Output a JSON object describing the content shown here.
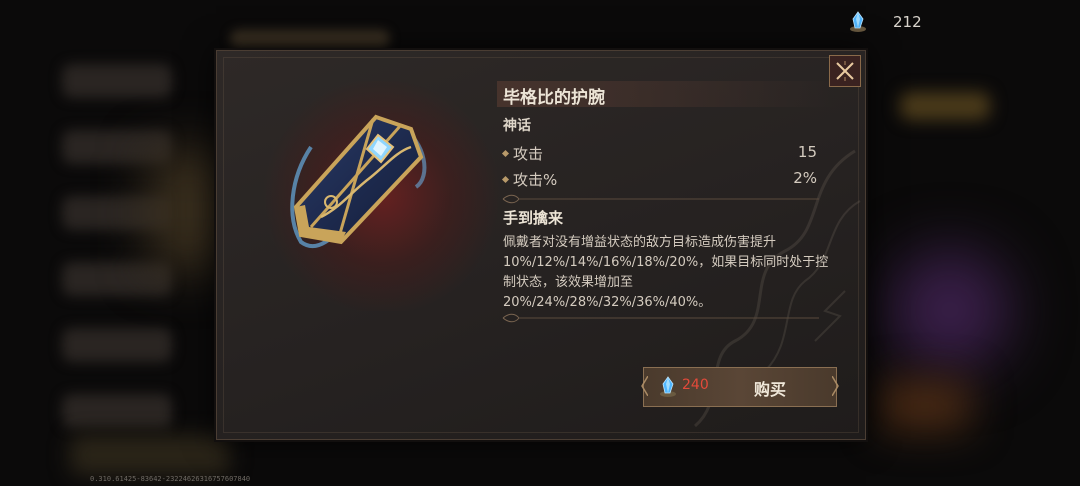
{
  "currency": {
    "icon": "blue-crystal-icon",
    "value": "212"
  },
  "item": {
    "name": "毕格比的护腕",
    "rarity": "神话",
    "stats": [
      {
        "label": "攻击",
        "value": "15"
      },
      {
        "label": "攻击%",
        "value": "2%"
      }
    ],
    "skill_name": "手到擒来",
    "skill_desc_lines": [
      "佩戴者对没有增益状态的敌方目标造成伤害提升",
      "10%/12%/14%/16%/18%/20%，如果目标同时处于控",
      "制状态，该效果增加至",
      "20%/24%/28%/32%/36%/40%。"
    ]
  },
  "buy": {
    "cost": "240",
    "label": "购买",
    "cost_color": "#e34a3a"
  },
  "version": "0.310.61425-83642-23224626316757607840",
  "colors": {
    "panel": "#2a2523",
    "accent": "#8a6f52",
    "crystal": "#4fb6ff"
  }
}
